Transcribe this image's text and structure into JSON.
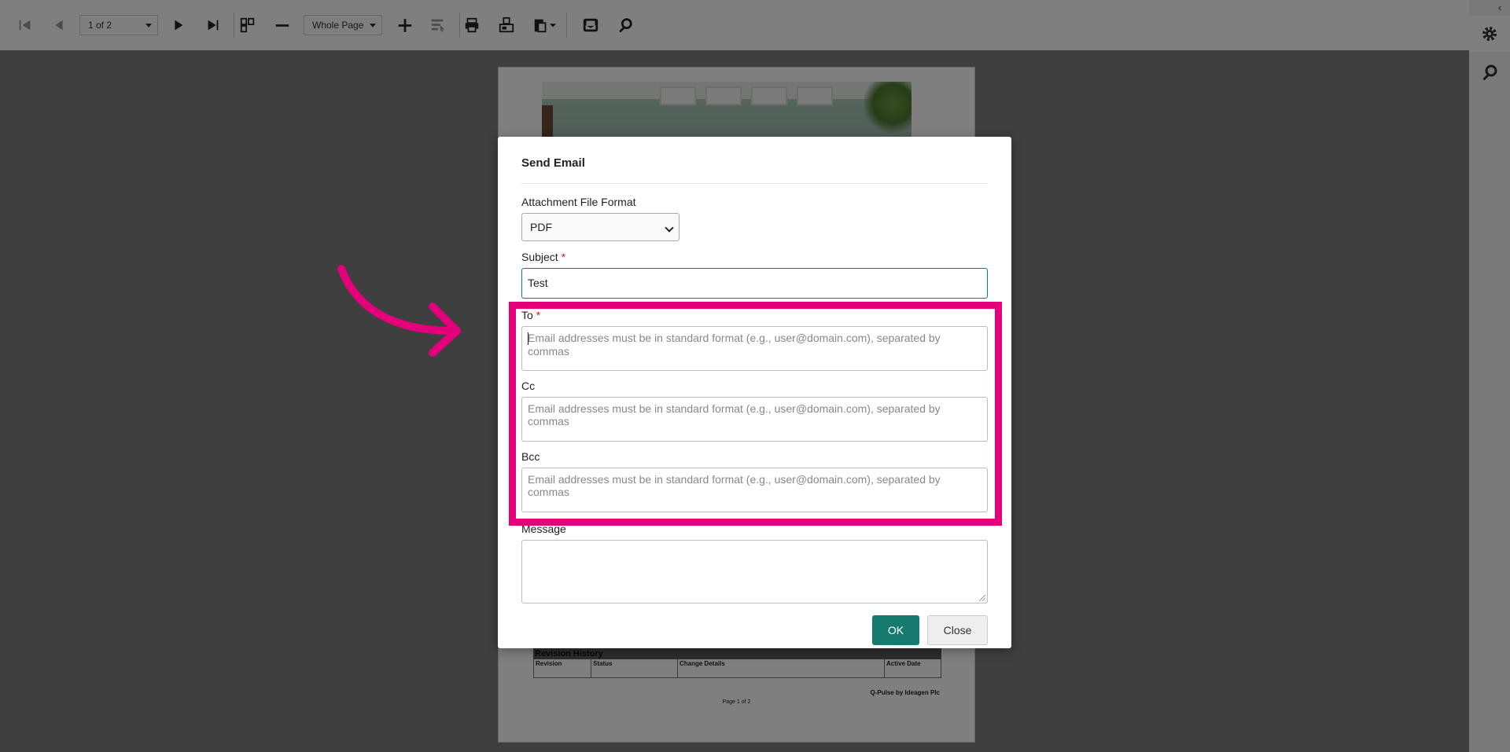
{
  "toolbar": {
    "page_indicator": "1 of 2",
    "zoom_level": "Whole Page",
    "icons": [
      "first-page-icon",
      "previous-page-icon",
      "next-page-icon",
      "last-page-icon",
      "thumbnails-icon",
      "zoom-out-icon",
      "zoom-in-icon",
      "select-tool-icon",
      "print-icon",
      "page-setup-icon",
      "export-icon",
      "send-email-icon",
      "search-icon"
    ]
  },
  "right_panel": {
    "icons": [
      "collapse-icon",
      "settings-gear-icon",
      "search-icon"
    ]
  },
  "document": {
    "revision_title": "Revision History",
    "revision_columns": [
      "Revision",
      "Status",
      "Change Details",
      "Active  Date"
    ],
    "footer_brand": "Q-Pulse by Ideagen Plc",
    "footer_page": "Page 1 of 2"
  },
  "dialog": {
    "title": "Send Email",
    "attachment_label": "Attachment File Format",
    "attachment_value": "PDF",
    "subject_label": "Subject",
    "subject_value": "Test",
    "required_marker": "*",
    "to_label": "To",
    "cc_label": "Cc",
    "bcc_label": "Bcc",
    "email_placeholder": "Email addresses must be in standard format (e.g., user@domain.com), separated by commas",
    "message_label": "Message",
    "ok_label": "OK",
    "close_label": "Close"
  },
  "colors": {
    "accent": "#167a6f",
    "highlight": "#e4007a",
    "required": "#d9261c"
  }
}
